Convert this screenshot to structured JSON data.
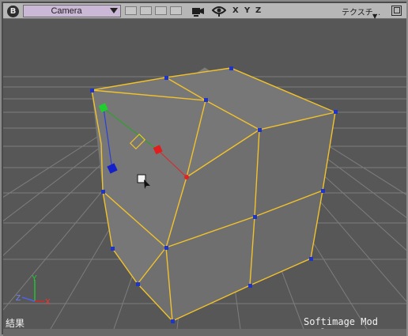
{
  "toolbar": {
    "badge": "B",
    "camera": "Camera",
    "axes": [
      "X",
      "Y",
      "Z"
    ],
    "texture_menu": "テクスチ...",
    "colors": {
      "camera_bg": "#cbb8d7",
      "bar_bg": "#b7b7b7"
    }
  },
  "viewport": {
    "status_left": "結果",
    "status_right": "Softimage Mod Tool",
    "axis_labels": {
      "x": "X",
      "y": "Y",
      "z": "Z"
    },
    "colors": {
      "grid_bg": "#585858",
      "edges": "#f2c22b",
      "points": "#1f35c7",
      "face": "#727272"
    }
  }
}
